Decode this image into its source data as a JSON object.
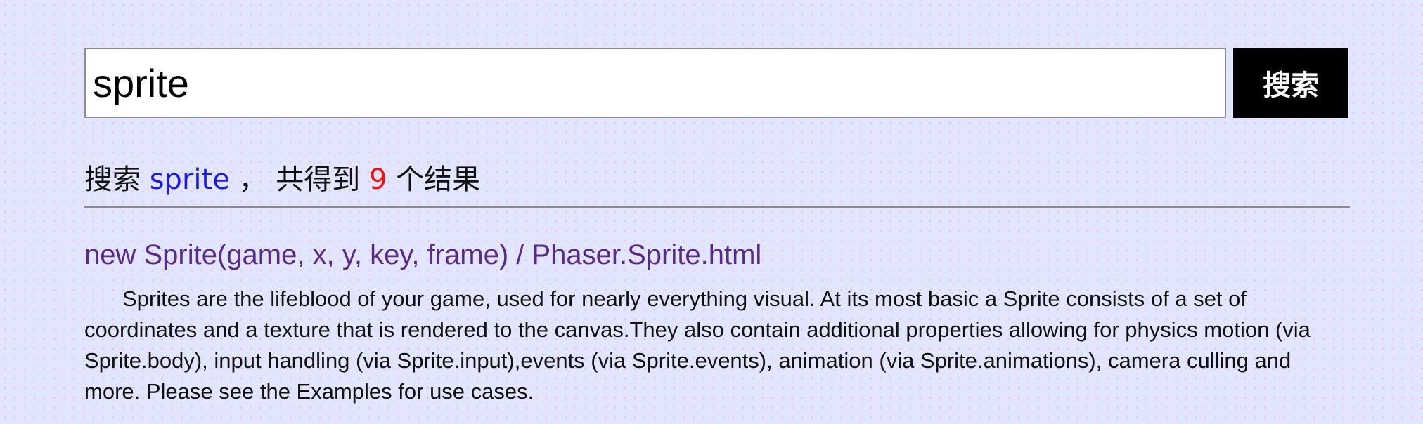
{
  "search": {
    "value": "sprite",
    "placeholder": "",
    "button_label": "搜索"
  },
  "summary": {
    "prefix": "搜索",
    "keyword": "sprite",
    "middle": "， 共得到",
    "count": "9",
    "suffix": "个结果"
  },
  "results": [
    {
      "title": "new Sprite(game, x, y, key, frame) / Phaser.Sprite.html",
      "description": "Sprites are the lifeblood of your game, used for nearly everything visual. At its most basic a Sprite consists of a set of coordinates and a texture that is rendered to the canvas.They also contain additional properties allowing for physics motion (via Sprite.body), input handling (via Sprite.input),events (via Sprite.events), animation (via Sprite.animations), camera culling and more. Please see the Examples for use cases."
    }
  ],
  "colors": {
    "keyword": "#1a1aee",
    "count": "#ee1111",
    "link": "#5a2a8a",
    "button_bg": "#000000"
  }
}
